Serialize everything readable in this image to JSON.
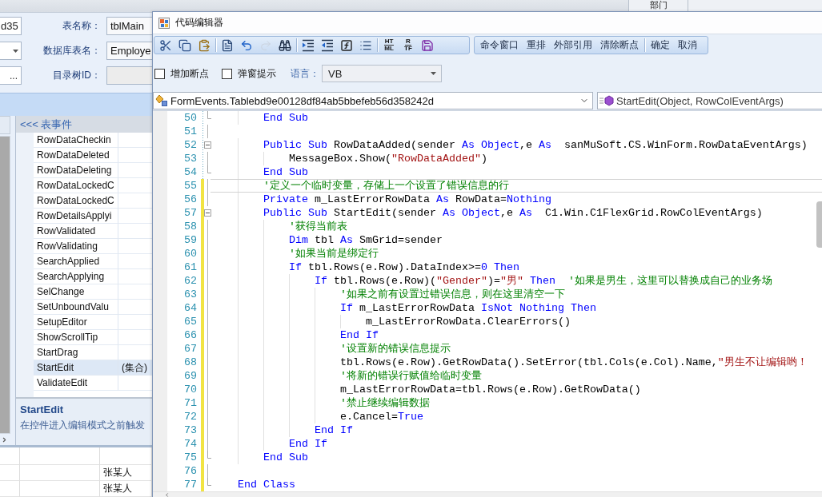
{
  "back_grid_header": {
    "columns": [
      "部门"
    ]
  },
  "main_form": {
    "rows": [
      {
        "side_field": {
          "kind": "text",
          "value": "d35"
        },
        "label": "表名称：",
        "field": {
          "value": "tblMain",
          "disabled": false
        }
      },
      {
        "side_field": {
          "kind": "dropdown"
        },
        "label": "数据库表名：",
        "field": {
          "value": "Employe",
          "disabled": false
        }
      },
      {
        "side_field": {
          "kind": "browse",
          "button": "..."
        },
        "label": "目录树ID：",
        "field": {
          "disabled": true
        }
      }
    ]
  },
  "event_grid": {
    "header": "<<< 表事件",
    "rows": [
      {
        "name": "RowDataCheckin",
        "selected": false
      },
      {
        "name": "RowDataDeleted",
        "selected": false
      },
      {
        "name": "RowDataDeleting",
        "selected": false
      },
      {
        "name": "RowDataLockedC",
        "selected": false
      },
      {
        "name": "RowDataLockedC",
        "selected": false
      },
      {
        "name": "RowDetailsApplyi",
        "selected": false
      },
      {
        "name": "RowValidated",
        "selected": false
      },
      {
        "name": "RowValidating",
        "selected": false
      },
      {
        "name": "SearchApplied",
        "selected": false
      },
      {
        "name": "SearchApplying",
        "selected": false
      },
      {
        "name": "SelChange",
        "selected": false
      },
      {
        "name": "SetUnboundValu",
        "selected": false
      },
      {
        "name": "SetupEditor",
        "selected": false
      },
      {
        "name": "ShowScrollTip",
        "selected": false
      },
      {
        "name": "StartDrag",
        "selected": false
      },
      {
        "name": "StartEdit",
        "value": "(集合)",
        "selected": true
      },
      {
        "name": "ValidateEdit",
        "selected": false
      }
    ]
  },
  "description": {
    "title": "StartEdit",
    "text": "在控件进入编辑模式之前触发"
  },
  "data_grid": {
    "rows": [
      {
        "column_3": "张某人"
      },
      {
        "column_3": "张某人"
      }
    ]
  },
  "code_editor": {
    "title": "代码编辑器",
    "edit_toolbar": [
      {
        "kind": "button",
        "disabled": false
      },
      {
        "kind": "button",
        "disabled": false
      },
      {
        "kind": "button",
        "disabled": false
      },
      {
        "kind": "separator"
      },
      {
        "kind": "button",
        "disabled": false
      },
      {
        "kind": "button",
        "disabled": false
      },
      {
        "kind": "button",
        "disabled": true
      },
      {
        "kind": "button",
        "disabled": false
      },
      {
        "kind": "separator"
      },
      {
        "kind": "button",
        "disabled": false
      },
      {
        "kind": "button",
        "disabled": false
      },
      {
        "kind": "button",
        "disabled": false
      },
      {
        "kind": "button",
        "disabled": false
      },
      {
        "kind": "separator"
      },
      {
        "kind": "stacked",
        "top": "HT",
        "bottom": "ML"
      },
      {
        "kind": "stacked",
        "top": "R",
        "bottom": "TF"
      },
      {
        "kind": "button",
        "disabled": false
      }
    ],
    "command_toolbar": [
      {
        "kind": "button",
        "label": "命令窗口"
      },
      {
        "kind": "button",
        "label": "重排"
      },
      {
        "kind": "button",
        "label": "外部引用"
      },
      {
        "kind": "button",
        "label": "清除断点"
      },
      {
        "kind": "separator"
      },
      {
        "kind": "button",
        "label": "确定"
      },
      {
        "kind": "button",
        "label": "取消"
      }
    ],
    "options": [
      {
        "label": "增加断点",
        "checked": false
      },
      {
        "label": "弹窗提示",
        "checked": false
      }
    ],
    "language": {
      "label": "语言：",
      "value": "VB"
    },
    "class_selector": "FormEvents.Tablebd9e00128df84ab5bbefeb56d358242d",
    "member_selector": "StartEdit(Object, RowColEventArgs)",
    "lines": [
      {
        "number": "50",
        "kind": "block_end",
        "modified": false,
        "current": false,
        "tokens": [
          {
            "kind": "keyword",
            "text": "        End Sub"
          }
        ]
      },
      {
        "number": "51",
        "kind": "block_body",
        "modified": false,
        "current": false
      },
      {
        "number": "52",
        "kind": "block_start",
        "modified": false,
        "current": false,
        "tokens": [
          {
            "kind": "keyword",
            "text": "        Public Sub"
          },
          {
            "kind": "plain",
            "text": " RowDataAdded(sender "
          },
          {
            "kind": "keyword",
            "text": "As Object"
          },
          {
            "kind": "plain",
            "text": ",e "
          },
          {
            "kind": "keyword",
            "text": "As"
          },
          {
            "kind": "plain",
            "text": "  sanMuSoft.CS.WinForm.RowDataEventArgs)"
          }
        ]
      },
      {
        "number": "53",
        "kind": "block_body",
        "modified": false,
        "current": false,
        "tokens": [
          {
            "kind": "plain",
            "text": "            MessageBox.Show("
          },
          {
            "kind": "string",
            "text": "\"RowDataAdded\""
          },
          {
            "kind": "plain",
            "text": ")"
          }
        ]
      },
      {
        "number": "54",
        "kind": "block_end",
        "modified": false,
        "current": false,
        "tokens": [
          {
            "kind": "keyword",
            "text": "        End Sub"
          }
        ]
      },
      {
        "number": "55",
        "kind": "block_body",
        "modified": true,
        "current": true,
        "tokens": [
          {
            "kind": "comment",
            "text": "        '定义一个临时变量，存储上一个设置了错误信息的行"
          }
        ]
      },
      {
        "number": "56",
        "kind": "block_body",
        "modified": true,
        "current": false,
        "tokens": [
          {
            "kind": "keyword",
            "text": "        Private"
          },
          {
            "kind": "plain",
            "text": " m_LastErrorRowData "
          },
          {
            "kind": "keyword",
            "text": "As"
          },
          {
            "kind": "plain",
            "text": " RowData="
          },
          {
            "kind": "keyword",
            "text": "Nothing"
          }
        ]
      },
      {
        "number": "57",
        "kind": "block_start",
        "modified": true,
        "current": false,
        "tokens": [
          {
            "kind": "keyword",
            "text": "        Public Sub"
          },
          {
            "kind": "plain",
            "text": " StartEdit(sender "
          },
          {
            "kind": "keyword",
            "text": "As Object"
          },
          {
            "kind": "plain",
            "text": ",e "
          },
          {
            "kind": "keyword",
            "text": "As"
          },
          {
            "kind": "plain",
            "text": "  C1.Win.C1FlexGrid.RowColEventArgs)"
          }
        ]
      },
      {
        "number": "58",
        "kind": "block_body",
        "modified": true,
        "current": false,
        "tokens": [
          {
            "kind": "comment",
            "text": "            '获得当前表"
          }
        ]
      },
      {
        "number": "59",
        "kind": "block_body",
        "modified": true,
        "current": false,
        "tokens": [
          {
            "kind": "keyword",
            "text": "            Dim"
          },
          {
            "kind": "plain",
            "text": " tbl "
          },
          {
            "kind": "keyword",
            "text": "As"
          },
          {
            "kind": "plain",
            "text": " SmGrid=sender"
          }
        ]
      },
      {
        "number": "60",
        "kind": "block_body",
        "modified": true,
        "current": false,
        "tokens": [
          {
            "kind": "comment",
            "text": "            '如果当前是绑定行"
          }
        ]
      },
      {
        "number": "61",
        "kind": "block_body",
        "modified": true,
        "current": false,
        "tokens": [
          {
            "kind": "keyword",
            "text": "            If"
          },
          {
            "kind": "plain",
            "text": " tbl.Rows(e.Row).DataIndex>="
          },
          {
            "kind": "keyword",
            "text": "0 Then"
          }
        ]
      },
      {
        "number": "62",
        "kind": "block_body",
        "modified": true,
        "current": false,
        "tokens": [
          {
            "kind": "keyword",
            "text": "                If"
          },
          {
            "kind": "plain",
            "text": " tbl.Rows(e.Row)("
          },
          {
            "kind": "string",
            "text": "\"Gender\""
          },
          {
            "kind": "plain",
            "text": ")="
          },
          {
            "kind": "string",
            "text": "\"男\""
          },
          {
            "kind": "keyword",
            "text": " Then"
          },
          {
            "kind": "comment",
            "text": "  '如果是男生，这里可以替换成自己的业务场"
          }
        ]
      },
      {
        "number": "63",
        "kind": "block_body",
        "modified": true,
        "current": false,
        "tokens": [
          {
            "kind": "comment",
            "text": "                    '如果之前有设置过错误信息，则在这里清空一下"
          }
        ]
      },
      {
        "number": "64",
        "kind": "block_body",
        "modified": true,
        "current": false,
        "tokens": [
          {
            "kind": "keyword",
            "text": "                    If"
          },
          {
            "kind": "plain",
            "text": " m_LastErrorRowData "
          },
          {
            "kind": "keyword",
            "text": "IsNot Nothing Then"
          }
        ]
      },
      {
        "number": "65",
        "kind": "block_body",
        "modified": true,
        "current": false,
        "tokens": [
          {
            "kind": "plain",
            "text": "                        m_LastErrorRowData.ClearErrors()"
          }
        ]
      },
      {
        "number": "66",
        "kind": "block_body",
        "modified": true,
        "current": false,
        "tokens": [
          {
            "kind": "keyword",
            "text": "                    End If"
          }
        ]
      },
      {
        "number": "67",
        "kind": "block_body",
        "modified": true,
        "current": false,
        "tokens": [
          {
            "kind": "comment",
            "text": "                    '设置新的错误信息提示"
          }
        ]
      },
      {
        "number": "68",
        "kind": "block_body",
        "modified": true,
        "current": false,
        "tokens": [
          {
            "kind": "plain",
            "text": "                    tbl.Rows(e.Row).GetRowData().SetError(tbl.Cols(e.Col).Name,"
          },
          {
            "kind": "string",
            "text": "\"男生不让编辑哟！"
          }
        ]
      },
      {
        "number": "69",
        "kind": "block_body",
        "modified": true,
        "current": false,
        "tokens": [
          {
            "kind": "comment",
            "text": "                    '将新的错误行赋值给临时变量"
          }
        ]
      },
      {
        "number": "70",
        "kind": "block_body",
        "modified": true,
        "current": false,
        "tokens": [
          {
            "kind": "plain",
            "text": "                    m_LastErrorRowData=tbl.Rows(e.Row).GetRowData()"
          }
        ]
      },
      {
        "number": "71",
        "kind": "block_body",
        "modified": true,
        "current": false,
        "tokens": [
          {
            "kind": "comment",
            "text": "                    '禁止继续编辑数据"
          }
        ]
      },
      {
        "number": "72",
        "kind": "block_body",
        "modified": true,
        "current": false,
        "tokens": [
          {
            "kind": "plain",
            "text": "                    e.Cancel="
          },
          {
            "kind": "keyword",
            "text": "True"
          }
        ]
      },
      {
        "number": "73",
        "kind": "block_body",
        "modified": true,
        "current": false,
        "tokens": [
          {
            "kind": "keyword",
            "text": "                End If"
          }
        ]
      },
      {
        "number": "74",
        "kind": "block_body",
        "modified": true,
        "current": false,
        "tokens": [
          {
            "kind": "keyword",
            "text": "            End If"
          }
        ]
      },
      {
        "number": "75",
        "kind": "block_end",
        "modified": true,
        "current": false,
        "tokens": [
          {
            "kind": "keyword",
            "text": "        End Sub"
          }
        ]
      },
      {
        "number": "76",
        "kind": "block_body",
        "modified": true,
        "current": false
      },
      {
        "number": "77",
        "kind": "block_end",
        "modified": true,
        "current": false,
        "tokens": [
          {
            "kind": "keyword",
            "text": "    End Class"
          }
        ]
      }
    ]
  }
}
